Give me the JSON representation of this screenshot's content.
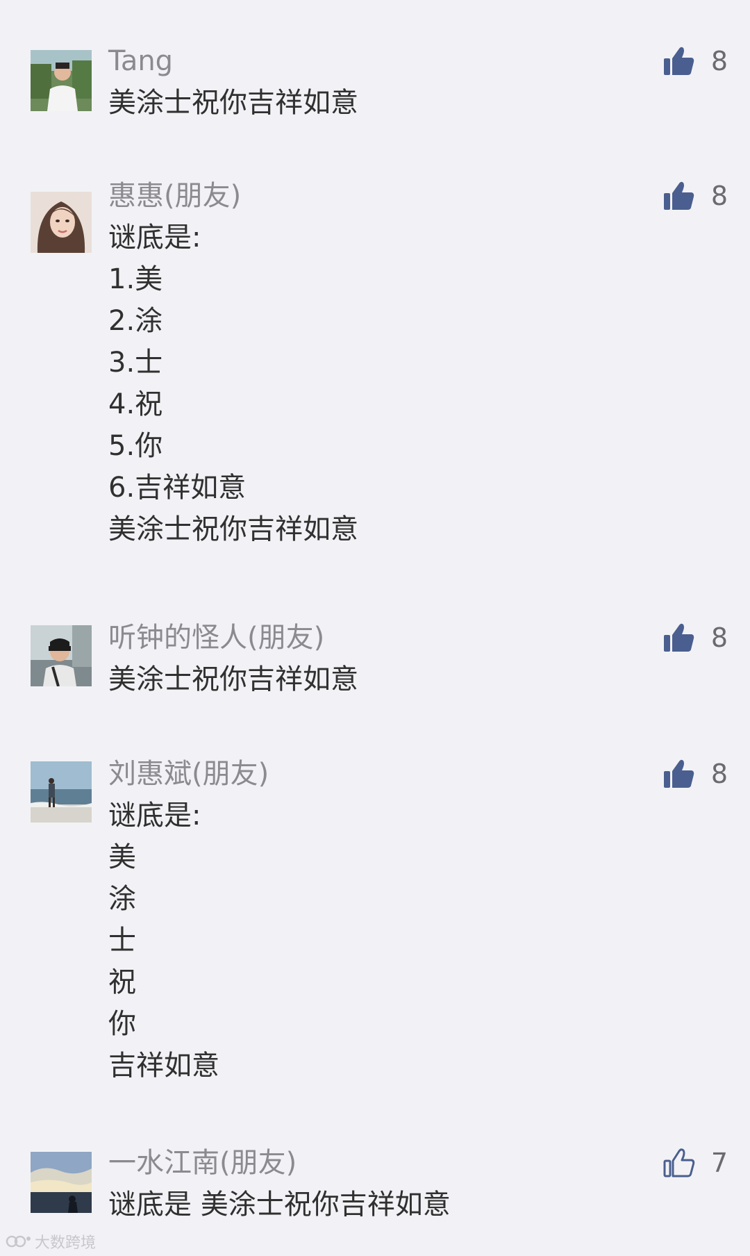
{
  "comments": [
    {
      "name": "Tang",
      "lines": [
        "美涂士祝你吉祥如意"
      ],
      "likes": "8",
      "liked": true,
      "avatar_icon": "person-photo-icon"
    },
    {
      "name": "惠惠(朋友)",
      "lines": [
        "谜底是:",
        "1.美",
        "2.涂",
        "3.士",
        "4.祝",
        "5.你",
        "6.吉祥如意",
        "美涂士祝你吉祥如意"
      ],
      "likes": "8",
      "liked": true,
      "avatar_icon": "woman-photo-icon"
    },
    {
      "name": "听钟的怪人(朋友)",
      "lines": [
        "美涂士祝你吉祥如意"
      ],
      "likes": "8",
      "liked": true,
      "avatar_icon": "man-photo-icon"
    },
    {
      "name": "刘惠斌(朋友)",
      "lines": [
        "谜底是:",
        "美",
        "涂",
        "士",
        "祝",
        "你",
        "吉祥如意"
      ],
      "likes": "8",
      "liked": true,
      "avatar_icon": "beach-photo-icon"
    },
    {
      "name": "一水江南(朋友)",
      "lines": [
        "谜底是 美涂士祝你吉祥如意"
      ],
      "likes": "7",
      "liked": false,
      "avatar_icon": "sunset-photo-icon"
    }
  ],
  "watermark": {
    "text": "大数跨境"
  },
  "colors": {
    "background": "#f2f2f6",
    "like_active": "#4a5f8f",
    "like_inactive": "#4a5f8f",
    "name": "#8a8a8f",
    "text": "#303030"
  }
}
